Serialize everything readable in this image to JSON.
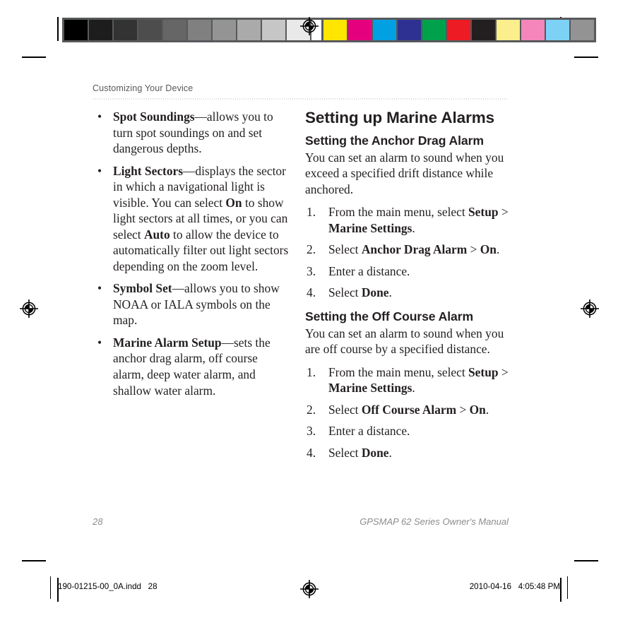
{
  "print_marks": {
    "grayscale_bar": {
      "label": "grayscale-calibration-bar",
      "swatches": [
        "#000000",
        "#1d1d1d",
        "#333333",
        "#4d4d4d",
        "#666666",
        "#808080",
        "#949494",
        "#aaaaaa",
        "#c6c6c6",
        "#e9e9e9",
        "#ffffff"
      ]
    },
    "color_bar": {
      "label": "color-calibration-bar",
      "swatches": [
        "#ffe600",
        "#e5007e",
        "#00a0e3",
        "#2e3192",
        "#00a14b",
        "#ed1c24",
        "#231f20",
        "#fbee8c",
        "#f486bb",
        "#7cd1f5",
        "#939393"
      ]
    },
    "registration_mark_label": "registration-target"
  },
  "header": {
    "running_head": "Customizing Your Device"
  },
  "left_column": {
    "bullet_glyph": "•",
    "bullets": [
      {
        "term": "Spot Soundings",
        "dash": "—",
        "text": "allows you to turn spot soundings on and set dangerous depths."
      },
      {
        "term": "Light Sectors",
        "dash": "—",
        "text_1": "displays the sector in which a navigational light is visible. You can select ",
        "emphasis_1": "On",
        "text_2": " to show light sectors at all times, or you can select ",
        "emphasis_2": "Auto",
        "text_3": " to allow the device to automatically filter out light sectors depending on the zoom level."
      },
      {
        "term": "Symbol Set",
        "dash": "—",
        "text": "allows you to show NOAA or IALA symbols on the map."
      },
      {
        "term": "Marine Alarm Setup",
        "dash": "—",
        "text": "sets the anchor drag alarm, off course alarm, deep water alarm, and shallow water alarm."
      }
    ]
  },
  "right_column": {
    "section_title": "Setting up Marine Alarms",
    "subsections": [
      {
        "heading": "Setting the Anchor Drag Alarm",
        "intro": "You can set an alarm to sound when you exceed a specified drift distance while anchored.",
        "steps": [
          {
            "num": "1.",
            "parts": [
              {
                "text": "From the main menu, select ",
                "bold": false
              },
              {
                "text": "Setup",
                "bold": true
              },
              {
                "text": " > ",
                "bold": false
              },
              {
                "text": "Marine Settings",
                "bold": true
              },
              {
                "text": ".",
                "bold": false
              }
            ]
          },
          {
            "num": "2.",
            "parts": [
              {
                "text": "Select ",
                "bold": false
              },
              {
                "text": "Anchor Drag Alarm",
                "bold": true
              },
              {
                "text": " > ",
                "bold": false
              },
              {
                "text": "On",
                "bold": true
              },
              {
                "text": ".",
                "bold": false
              }
            ]
          },
          {
            "num": "3.",
            "parts": [
              {
                "text": "Enter a distance.",
                "bold": false
              }
            ]
          },
          {
            "num": "4.",
            "parts": [
              {
                "text": "Select ",
                "bold": false
              },
              {
                "text": "Done",
                "bold": true
              },
              {
                "text": ".",
                "bold": false
              }
            ]
          }
        ]
      },
      {
        "heading": "Setting the Off Course Alarm",
        "intro": "You can set an alarm to sound when you are off course by a specified distance.",
        "steps": [
          {
            "num": "1.",
            "parts": [
              {
                "text": "From the main menu, select ",
                "bold": false
              },
              {
                "text": "Setup",
                "bold": true
              },
              {
                "text": " > ",
                "bold": false
              },
              {
                "text": "Marine Settings",
                "bold": true
              },
              {
                "text": ".",
                "bold": false
              }
            ]
          },
          {
            "num": "2.",
            "parts": [
              {
                "text": "Select ",
                "bold": false
              },
              {
                "text": "Off Course Alarm",
                "bold": true
              },
              {
                "text": " > ",
                "bold": false
              },
              {
                "text": "On",
                "bold": true
              },
              {
                "text": ".",
                "bold": false
              }
            ]
          },
          {
            "num": "3.",
            "parts": [
              {
                "text": "Enter a distance.",
                "bold": false
              }
            ]
          },
          {
            "num": "4.",
            "parts": [
              {
                "text": "Select ",
                "bold": false
              },
              {
                "text": "Done",
                "bold": true
              },
              {
                "text": ".",
                "bold": false
              }
            ]
          }
        ]
      }
    ]
  },
  "footer": {
    "page_number": "28",
    "manual_title": "GPSMAP 62 Series Owner's Manual"
  },
  "slug": {
    "file_name": "190-01215-00_0A.indd   28",
    "timestamp": "2010-04-16   4:05:48 PM"
  }
}
